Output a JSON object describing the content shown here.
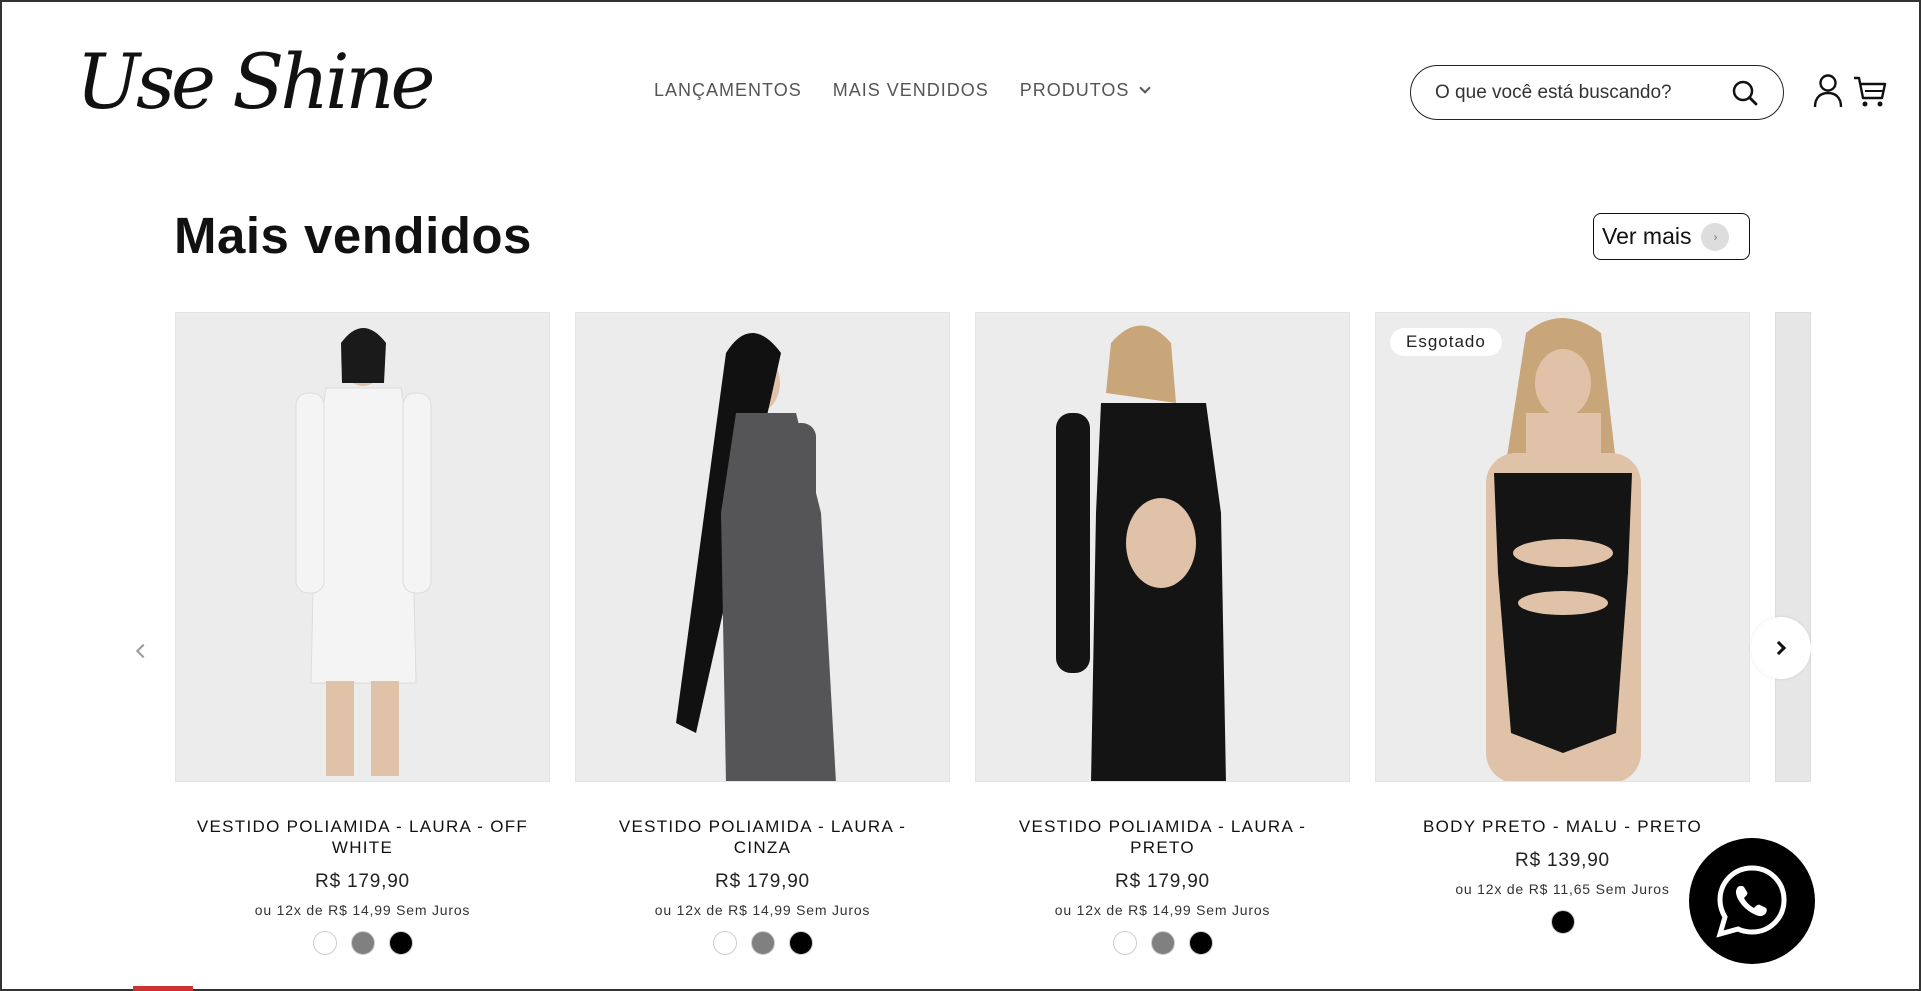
{
  "header": {
    "logo_text": "Use Shine",
    "nav": [
      {
        "label": "LANÇAMENTOS"
      },
      {
        "label": "MAIS VENDIDOS"
      },
      {
        "label": "PRODUTOS"
      }
    ],
    "search_placeholder": "O que você está buscando?",
    "icons": [
      "search-icon",
      "user-icon",
      "cart-icon"
    ]
  },
  "section": {
    "title": "Mais vendidos",
    "ver_mais_label": "Ver mais"
  },
  "products": [
    {
      "name": "VESTIDO POLIAMIDA - LAURA - OFF WHITE",
      "price": "R$ 179,90",
      "installments": "ou 12x de R$ 14,99 Sem Juros",
      "swatches": [
        "#ffffff",
        "#808080",
        "#000000"
      ],
      "badge": ""
    },
    {
      "name": "VESTIDO POLIAMIDA - LAURA - CINZA",
      "price": "R$ 179,90",
      "installments": "ou 12x de R$ 14,99 Sem Juros",
      "swatches": [
        "#ffffff",
        "#808080",
        "#000000"
      ],
      "badge": ""
    },
    {
      "name": "VESTIDO POLIAMIDA - LAURA - PRETO",
      "price": "R$ 179,90",
      "installments": "ou 12x de R$ 14,99 Sem Juros",
      "swatches": [
        "#ffffff",
        "#808080",
        "#000000"
      ],
      "badge": ""
    },
    {
      "name": "BODY PRETO - MALU - PRETO",
      "price": "R$ 139,90",
      "installments": "ou 12x de R$ 11,65 Sem Juros",
      "swatches": [
        "#000000"
      ],
      "badge": "Esgotado"
    }
  ],
  "garment_colors": [
    "#f4f4f4",
    "#555558",
    "#141414",
    "#141414"
  ],
  "icons": {
    "prev": "chevron-left-icon",
    "next": "chevron-right-icon",
    "whatsapp": "whatsapp-icon"
  }
}
